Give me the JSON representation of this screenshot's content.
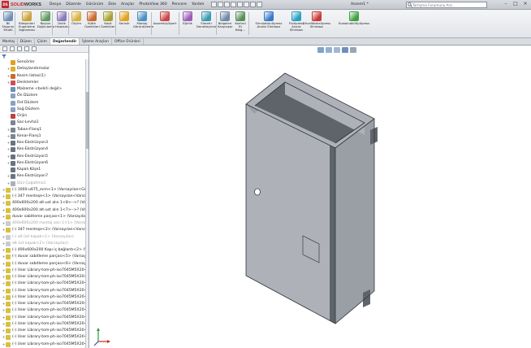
{
  "app": {
    "brand_prefix": "SOLID",
    "brand_suffix": "WORKS",
    "document_title": "Assem1 *",
    "accent_color": "#c8242b"
  },
  "menus": [
    "Dosya",
    "Düzenle",
    "Görünüm",
    "Ekle",
    "Araçlar",
    "PhotoView 360",
    "Pencere",
    "Yardım"
  ],
  "search": {
    "placeholder": "Tartışma Forumunu Ara"
  },
  "commands": [
    {
      "label": "Bil\nTasarım\nEtüdü",
      "icon": "design-study-icon"
    },
    {
      "label": "Bileşenleri\nEngelleme\nAlgılaması",
      "icon": "interference-detection-icon"
    },
    {
      "label": "Boşluk\nDoğrulama",
      "icon": "clearance-verification-icon"
    },
    {
      "label": "Delik\nHizalama",
      "icon": "hole-alignment-icon"
    },
    {
      "label": "Ölçüm",
      "icon": "measure-icon"
    },
    {
      "label": "Kütle\nÖzellikleri",
      "icon": "mass-properties-icon"
    },
    {
      "label": "Kesit\nÖzellikleri",
      "icon": "section-properties-icon"
    },
    {
      "label": "Sensör",
      "icon": "sensor-icon"
    },
    {
      "label": "Montaj\nGörüntüleme",
      "icon": "assembly-visualization-icon"
    },
    {
      "label": "AssemblyXpert",
      "icon": "assemblyxpert-icon"
    },
    {
      "label": "Eğrilik",
      "icon": "curvature-icon"
    },
    {
      "label": "Simetri\nDenetleyicisi",
      "icon": "symmetry-check-icon"
    },
    {
      "label": "Belgeleri\nKarşılaştır",
      "icon": "compare-documents-icon"
    },
    {
      "label": "Kontrol\nEt\nBelg...",
      "icon": "check-active-document-icon"
    },
    {
      "label": "SimulationXpress\nAnaliz Sihirbazı",
      "icon": "simulationxpress-icon"
    },
    {
      "label": "FloXpress\nAnaliz\nSihirbazı",
      "icon": "floxpress-icon"
    },
    {
      "label": "DriveWorksXpress\nSihirbazı",
      "icon": "driveworksxpress-icon"
    },
    {
      "label": "SustainabilityXpress",
      "icon": "sustainabilityxpress-icon"
    }
  ],
  "tabs": [
    {
      "label": "Montaj",
      "active": false
    },
    {
      "label": "Düzen",
      "active": false
    },
    {
      "label": "Çizim",
      "active": false
    },
    {
      "label": "Değerlendir",
      "active": true
    },
    {
      "label": "İşleme Araçları",
      "active": false
    },
    {
      "label": "Office Ürünleri",
      "active": false
    }
  ],
  "feature_tree": [
    {
      "text": "Sensörler",
      "icon": "sensor-folder-icon",
      "color": "#e0a020",
      "expand": "",
      "dim": false
    },
    {
      "text": "Detaylandırmalar",
      "icon": "annotations-icon",
      "color": "#d9b030",
      "expand": "+",
      "dim": false
    },
    {
      "text": "Kesim listesi(1)",
      "icon": "cut-list-icon",
      "color": "#c86a30",
      "expand": "+",
      "dim": false
    },
    {
      "text": "Denklemler",
      "icon": "equations-icon",
      "color": "#d05050",
      "expand": "+",
      "dim": false
    },
    {
      "text": "Malzeme <belirli değil>",
      "icon": "material-icon",
      "color": "#6d8fb8",
      "expand": "",
      "dim": false
    },
    {
      "text": "Ön Düzlem",
      "icon": "plane-icon",
      "color": "#8aa0c0",
      "expand": "",
      "dim": false
    },
    {
      "text": "Üst Düzlem",
      "icon": "plane-icon",
      "color": "#8aa0c0",
      "expand": "",
      "dim": false
    },
    {
      "text": "Sağ Düzlem",
      "icon": "plane-icon",
      "color": "#8aa0c0",
      "expand": "",
      "dim": false
    },
    {
      "text": "Orijin",
      "icon": "origin-icon",
      "color": "#c04040",
      "expand": "",
      "dim": false
    },
    {
      "text": "Sac-Levha1",
      "icon": "sheet-metal-icon",
      "color": "#7a8590",
      "expand": "",
      "dim": false
    },
    {
      "text": "Taban-Flanş1",
      "icon": "base-flange-icon",
      "color": "#7a8590",
      "expand": "+",
      "dim": false
    },
    {
      "text": "Kenar-Flanş1",
      "icon": "edge-flange-icon",
      "color": "#7a8590",
      "expand": "+",
      "dim": false
    },
    {
      "text": "Kes-Ekstrüzyon3",
      "icon": "cut-extrude-icon",
      "color": "#6a7480",
      "expand": "+",
      "dim": false
    },
    {
      "text": "Kes-Ekstrüzyon4",
      "icon": "cut-extrude-icon",
      "color": "#6a7480",
      "expand": "+",
      "dim": false
    },
    {
      "text": "Kes-Ekstrüzyon5",
      "icon": "cut-extrude-icon",
      "color": "#6a7480",
      "expand": "+",
      "dim": false
    },
    {
      "text": "Kes-Ekstrüzyon6",
      "icon": "cut-extrude-icon",
      "color": "#6a7480",
      "expand": "+",
      "dim": false
    },
    {
      "text": "Kapalı Köşe1",
      "icon": "closed-corner-icon",
      "color": "#6a7480",
      "expand": "",
      "dim": false
    },
    {
      "text": "Kes-Ekstrüzyon7",
      "icon": "cut-extrude-icon",
      "color": "#6a7480",
      "expand": "+",
      "dim": false
    },
    {
      "text": "Düz-Çoğaltma1",
      "icon": "flat-pattern-icon",
      "color": "#a8b0b8",
      "expand": "+",
      "dim": true
    },
    {
      "text": "(-) 1000-u675_ecm<1> (Varsayılan<Görünt",
      "icon": "part-icon",
      "color": "#d8c040",
      "expand": "+",
      "dim": false
    },
    {
      "text": "(-) 347 menteşe<1> (Varsayılan<Varsayıla",
      "icon": "part-icon",
      "color": "#d8c040",
      "expand": "+",
      "dim": false
    },
    {
      "text": "400x600x200 alt-ust alın 1<8>-->? (Varsayıla",
      "icon": "part-icon",
      "color": "#d8c040",
      "expand": "+",
      "dim": false
    },
    {
      "text": "400x600x200 alt-ust alın 1<7>-->? (Varsayıla",
      "icon": "part-icon",
      "color": "#d8c040",
      "expand": "+",
      "dim": false
    },
    {
      "text": "duvar sabitleme parçası<1> (Varsayılan<<\\",
      "icon": "part-icon",
      "color": "#d8c040",
      "expand": "+",
      "dim": false
    },
    {
      "text": "400x600x200 montaj sacı 1<1> (Varsayılan",
      "icon": "part-icon",
      "color": "#c8ccd0",
      "expand": "+",
      "dim": true
    },
    {
      "text": "(-) 347 menteşe<2> (Varsayılan<Varsayıla",
      "icon": "part-icon",
      "color": "#d8c040",
      "expand": "+",
      "dim": false
    },
    {
      "text": "(-) alt üst kapak<1> (Varsayılan)",
      "icon": "part-icon",
      "color": "#c8ccd0",
      "expand": "+",
      "dim": true
    },
    {
      "text": "alt üst kapak<2> (Varsayılan)",
      "icon": "part-icon",
      "color": "#c8ccd0",
      "expand": "+",
      "dim": true
    },
    {
      "text": "(-) 400x600x200 Kapı iç bağlantı<2> (Varsa",
      "icon": "part-icon",
      "color": "#d8c040",
      "expand": "+",
      "dim": false
    },
    {
      "text": "(-) duvar sabitleme parçası<5> (Varsayılan",
      "icon": "part-icon",
      "color": "#d8c040",
      "expand": "+",
      "dim": false
    },
    {
      "text": "(-) duvar sabitleme parçası<6> (Varsayılan",
      "icon": "part-icon",
      "color": "#d8c040",
      "expand": "+",
      "dim": false
    },
    {
      "text": "(-) User Library-tom-ph-iso7045M5X20<2>",
      "icon": "part-icon",
      "color": "#d8c040",
      "expand": "+",
      "dim": false
    },
    {
      "text": "(-) User Library-tom-ph-iso7045M5X20<5>",
      "icon": "part-icon",
      "color": "#d8c040",
      "expand": "+",
      "dim": false
    },
    {
      "text": "(-) User Library-tom-ph-iso7045M5X20<8>",
      "icon": "part-icon",
      "color": "#d8c040",
      "expand": "+",
      "dim": false
    },
    {
      "text": "(-) User Library-tom-ph-iso7045M5X20<9>",
      "icon": "part-icon",
      "color": "#d8c040",
      "expand": "+",
      "dim": false
    },
    {
      "text": "(-) User Library-tom-ph-iso7045M5X20<10>",
      "icon": "part-icon",
      "color": "#d8c040",
      "expand": "+",
      "dim": false
    },
    {
      "text": "(-) User Library-tom-ph-iso7045M5X20<11>",
      "icon": "part-icon",
      "color": "#d8c040",
      "expand": "+",
      "dim": false
    },
    {
      "text": "(-) User Library-tom-ph-iso7045M5X20<12>",
      "icon": "part-icon",
      "color": "#d8c040",
      "expand": "+",
      "dim": false
    },
    {
      "text": "(-) User Library-tom-ph-iso7045M5X20<13>",
      "icon": "part-icon",
      "color": "#d8c040",
      "expand": "+",
      "dim": false
    },
    {
      "text": "(-) User Library-tom-ph-iso7045M5X20<14>",
      "icon": "part-icon",
      "color": "#d8c040",
      "expand": "+",
      "dim": false
    },
    {
      "text": "(-) User Library-tom-ph-iso7045M5X20<15>",
      "icon": "part-icon",
      "color": "#d8c040",
      "expand": "+",
      "dim": false
    },
    {
      "text": "(-) User Library-tom-ph-iso7045M5X20<16>",
      "icon": "part-icon",
      "color": "#d8c040",
      "expand": "+",
      "dim": false
    },
    {
      "text": "(-) User Library-tom-ph-iso7045M5X20<17>",
      "icon": "part-icon",
      "color": "#d8c040",
      "expand": "+",
      "dim": false
    }
  ],
  "model": {
    "body_color": "#aeb2b8",
    "side_color": "#9a9fa6",
    "dark_color": "#5f646b"
  }
}
